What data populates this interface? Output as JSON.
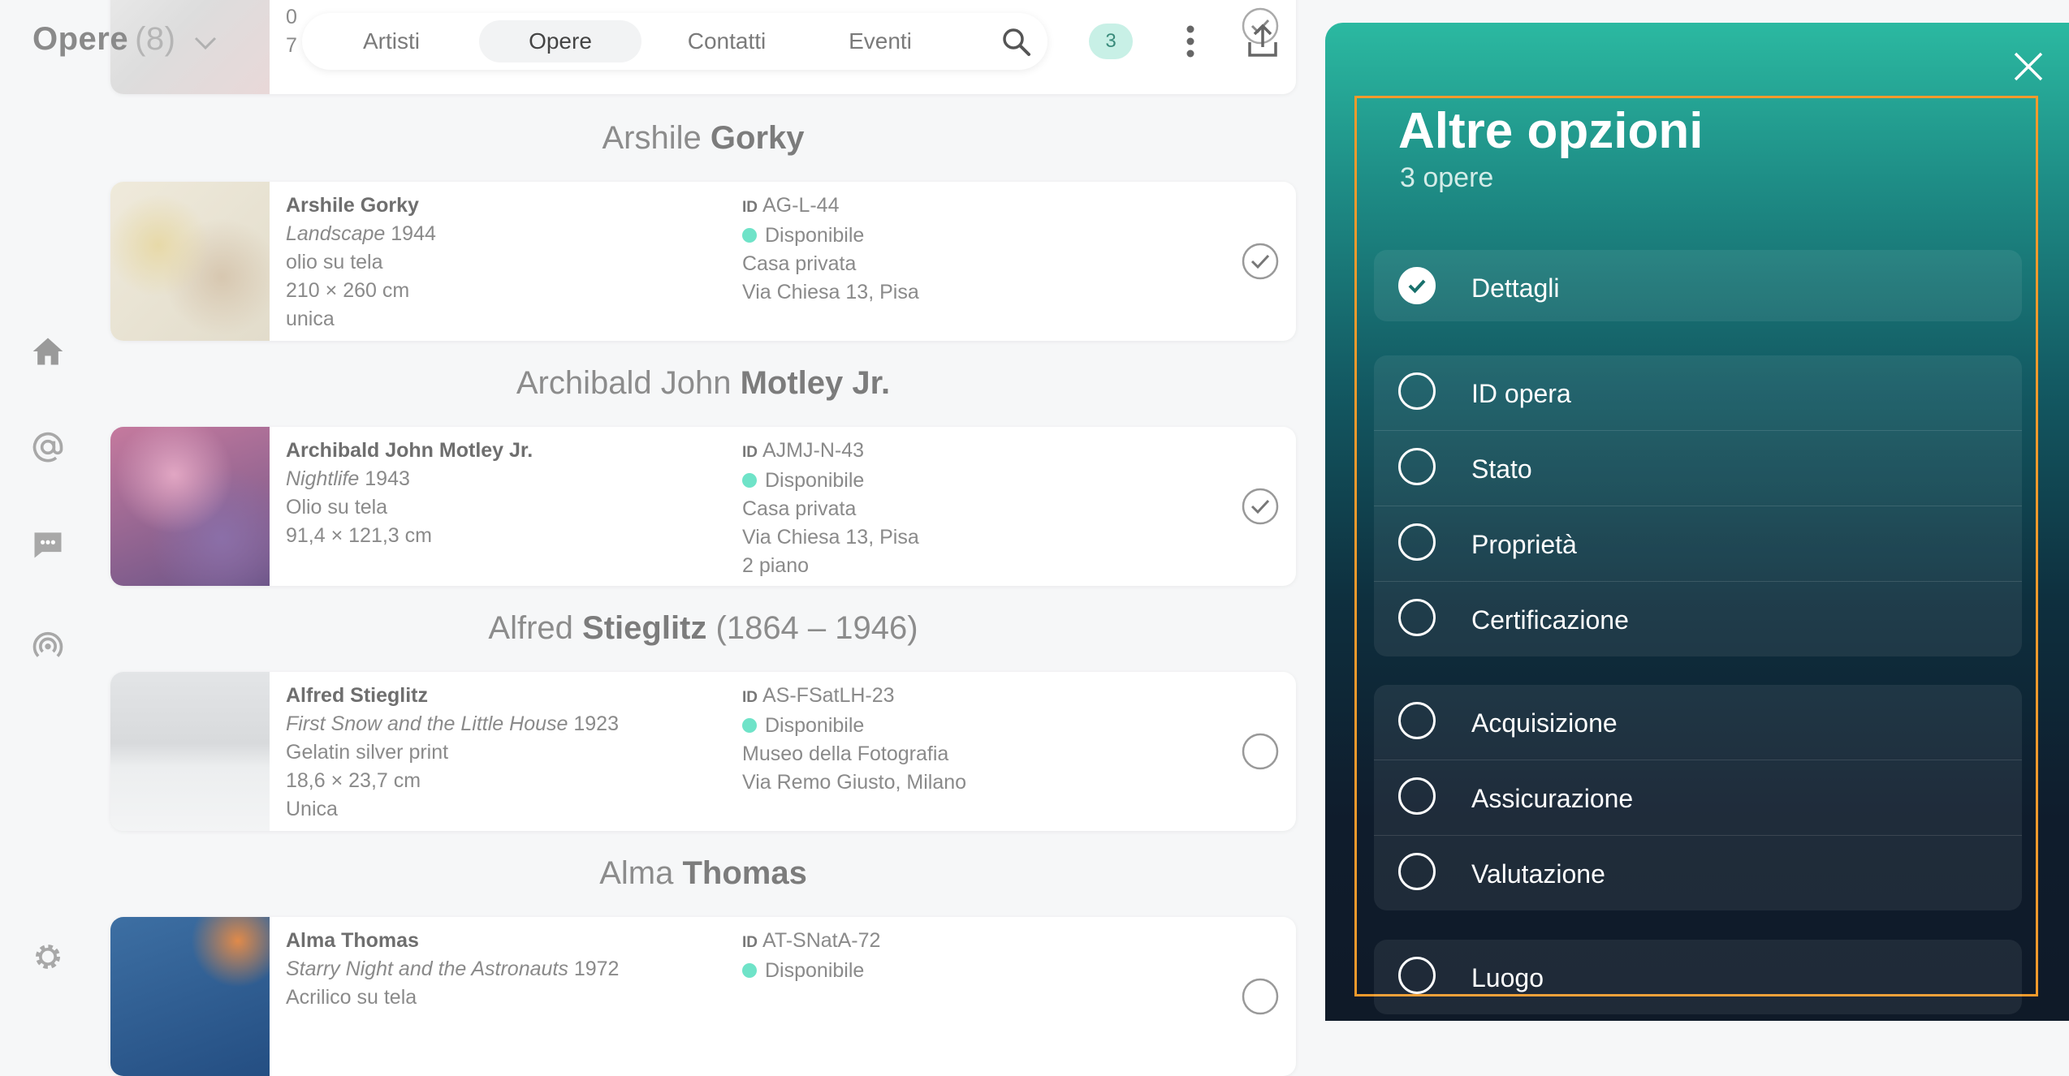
{
  "collection": {
    "title": "Opere",
    "count": "(8)"
  },
  "nav": {
    "tabs": [
      "Artisti",
      "Opere",
      "Contatti",
      "Eventi"
    ],
    "active": "Opere"
  },
  "selection_count": "3",
  "top_partial": {
    "line1": "0",
    "line2": "7"
  },
  "artworks": [
    {
      "heading_light": "Arshile",
      "heading_bold": "Gorky",
      "heading_suffix": "",
      "artist": "Arshile Gorky",
      "title": "Landscape",
      "year": "1944",
      "medium": "olio su tela",
      "size": "210 × 260 cm",
      "edition": "unica",
      "id_label": "ID",
      "id": "AG-L-44",
      "status": "Disponibile",
      "location": "Casa privata",
      "address": "Via Chiesa 13, Pisa",
      "floor": "",
      "selected": true
    },
    {
      "heading_light": "Archibald John",
      "heading_bold": "Motley Jr.",
      "heading_suffix": "",
      "artist": "Archibald John Motley Jr.",
      "title": "Nightlife",
      "year": "1943",
      "medium": "Olio su tela",
      "size": "91,4 × 121,3 cm",
      "edition": "",
      "id_label": "ID",
      "id": "AJMJ-N-43",
      "status": "Disponibile",
      "location": "Casa privata",
      "address": "Via Chiesa 13, Pisa",
      "floor": "2 piano",
      "selected": true
    },
    {
      "heading_light": "Alfred",
      "heading_bold": "Stieglitz",
      "heading_suffix": "(1864 – 1946)",
      "artist": "Alfred Stieglitz",
      "title": "First Snow and the Little House",
      "year": "1923",
      "medium": "Gelatin silver print",
      "size": "18,6 × 23,7 cm",
      "edition": "Unica",
      "id_label": "ID",
      "id": "AS-FSatLH-23",
      "status": "Disponibile",
      "location": "Museo della Fotografia",
      "address": "Via Remo Giusto, Milano",
      "floor": "",
      "selected": false
    },
    {
      "heading_light": "Alma",
      "heading_bold": "Thomas",
      "heading_suffix": "",
      "artist": "Alma Thomas",
      "title": "Starry Night and the Astronauts",
      "year": "1972",
      "medium": "Acrilico su tela",
      "size": "",
      "edition": "",
      "id_label": "ID",
      "id": "AT-SNatA-72",
      "status": "Disponibile",
      "location": "",
      "address": "",
      "floor": "",
      "selected": false
    }
  ],
  "panel": {
    "title": "Altre opzioni",
    "subtitle": "3 opere",
    "groups": [
      [
        {
          "label": "Dettagli",
          "checked": true
        }
      ],
      [
        {
          "label": "ID opera",
          "checked": false
        },
        {
          "label": "Stato",
          "checked": false
        },
        {
          "label": "Proprietà",
          "checked": false
        },
        {
          "label": "Certificazione",
          "checked": false
        }
      ],
      [
        {
          "label": "Acquisizione",
          "checked": false
        },
        {
          "label": "Assicurazione",
          "checked": false
        },
        {
          "label": "Valutazione",
          "checked": false
        }
      ],
      [
        {
          "label": "Luogo",
          "checked": false
        }
      ]
    ]
  },
  "icons": {
    "rail": [
      "home-icon",
      "at-sign-icon",
      "chat-icon",
      "broadcast-icon",
      "settings-gear-icon"
    ],
    "toolbar": [
      "search-icon",
      "more-vertical-icon",
      "share-upload-icon",
      "close-icon"
    ]
  },
  "colors": {
    "accent": "#2bb9a1",
    "status_dot": "#6fe3c8",
    "badge_bg": "#c8f0e6",
    "focus_frame": "#f39a2c"
  }
}
